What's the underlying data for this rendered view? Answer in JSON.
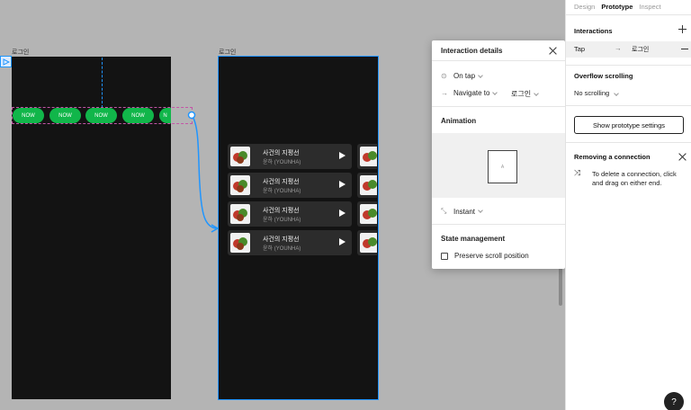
{
  "canvas": {
    "frame_left_label": "로그인",
    "frame_right_label": "로그인",
    "pills": [
      "NOW",
      "NOW",
      "NOW",
      "NOW",
      "N"
    ],
    "cards": [
      {
        "title": "사건의 지평선",
        "artist": "윤하 (YOUNHA)"
      },
      {
        "title": "사건의 지평선",
        "artist": "윤하 (YOUNHA)"
      },
      {
        "title": "사건의 지평선",
        "artist": "윤하 (YOUNHA)"
      },
      {
        "title": "사건의 지평선",
        "artist": "윤하 (YOUNHA)"
      }
    ]
  },
  "popup": {
    "title": "Interaction details",
    "trigger": "On tap",
    "action": "Navigate to",
    "destination": "로그인",
    "animation_title": "Animation",
    "preview_label": "A",
    "animation_type": "Instant",
    "state_title": "State management",
    "preserve_scroll": "Preserve scroll position"
  },
  "panel": {
    "tabs": [
      "Design",
      "Prototype",
      "Inspect"
    ],
    "interactions_title": "Interactions",
    "interaction_trigger": "Tap",
    "interaction_target": "로그인",
    "overflow_title": "Overflow scrolling",
    "overflow_value": "No scrolling",
    "show_settings_button": "Show prototype settings",
    "removing_title": "Removing a connection",
    "removing_text": "To delete a connection, click and drag on either end.",
    "help": "?"
  },
  "colors": {
    "accent": "#1f95ff",
    "pill": "#11b64a",
    "frame_bg": "#131313",
    "card_bg": "#2c2c2c"
  }
}
